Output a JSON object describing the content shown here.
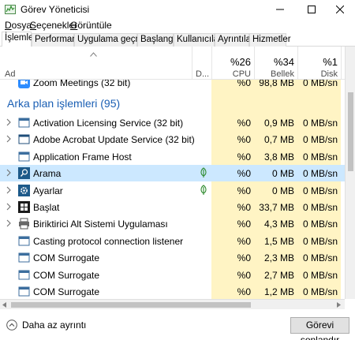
{
  "window": {
    "title": "Görev Yöneticisi"
  },
  "menu": [
    {
      "u": "D",
      "rest": "osya"
    },
    {
      "u": "S",
      "rest": "eçenekler"
    },
    {
      "u": "G",
      "rest": "örüntüle"
    }
  ],
  "tabs": [
    "İşlemler",
    "Performans",
    "Uygulama geçmişi",
    "Başlangıç",
    "Kullanıcılar",
    "Ayrıntılar",
    "Hizmetler"
  ],
  "header": {
    "name_col": "Ad",
    "status_col": "D...",
    "cpu": {
      "pct": "%26",
      "label": "CPU"
    },
    "memory": {
      "pct": "%34",
      "label": "Bellek"
    },
    "disk": {
      "pct": "%1",
      "label": "Disk"
    }
  },
  "partial_row": {
    "name": "Zoom Meetings (32 bit)",
    "cpu": "%0",
    "memory": "98,8 MB",
    "disk": "0 MB/sn"
  },
  "group": {
    "title": "Arka plan işlemleri (95)"
  },
  "rows": [
    {
      "name": "Activation Licensing Service (32 bit)",
      "cpu": "%0",
      "memory": "0,9 MB",
      "disk": "0 MB/sn",
      "icon": "service-window-icon",
      "expandable": true,
      "leaf": false
    },
    {
      "name": "Adobe Acrobat Update Service (32 bit)",
      "cpu": "%0",
      "memory": "0,7 MB",
      "disk": "0 MB/sn",
      "icon": "app-window-icon",
      "expandable": true,
      "leaf": false
    },
    {
      "name": "Application Frame Host",
      "cpu": "%0",
      "memory": "3,8 MB",
      "disk": "0 MB/sn",
      "icon": "service-window-icon",
      "expandable": false,
      "leaf": false
    },
    {
      "name": "Arama",
      "cpu": "%0",
      "memory": "0 MB",
      "disk": "0 MB/sn",
      "icon": "search-app-icon",
      "expandable": true,
      "leaf": true,
      "selected": true
    },
    {
      "name": "Ayarlar",
      "cpu": "%0",
      "memory": "0 MB",
      "disk": "0 MB/sn",
      "icon": "settings-gear-icon",
      "expandable": true,
      "leaf": true
    },
    {
      "name": "Başlat",
      "cpu": "%0",
      "memory": "33,7 MB",
      "disk": "0 MB/sn",
      "icon": "start-app-icon",
      "expandable": true,
      "leaf": false
    },
    {
      "name": "Biriktirici Alt Sistemi Uygulaması",
      "cpu": "%0",
      "memory": "4,3 MB",
      "disk": "0 MB/sn",
      "icon": "printer-icon",
      "expandable": true,
      "leaf": false
    },
    {
      "name": "Casting protocol connection listener",
      "cpu": "%0",
      "memory": "1,5 MB",
      "disk": "0 MB/sn",
      "icon": "service-window-icon",
      "expandable": false,
      "leaf": false
    },
    {
      "name": "COM Surrogate",
      "cpu": "%0",
      "memory": "2,3 MB",
      "disk": "0 MB/sn",
      "icon": "service-window-icon",
      "expandable": false,
      "leaf": false
    },
    {
      "name": "COM Surrogate",
      "cpu": "%0",
      "memory": "2,7 MB",
      "disk": "0 MB/sn",
      "icon": "service-window-icon",
      "expandable": false,
      "leaf": false
    },
    {
      "name": "COM Surrogate",
      "cpu": "%0",
      "memory": "1,2 MB",
      "disk": "0 MB/sn",
      "icon": "service-window-icon",
      "expandable": false,
      "leaf": false
    }
  ],
  "footer": {
    "fewer_details": "Daha az ayrıntı",
    "end_task": "Görevi sonlandır"
  },
  "colors": {
    "highlight": "#fff4c4",
    "selected": "#cce8ff",
    "group_title": "#1a5fb4"
  }
}
